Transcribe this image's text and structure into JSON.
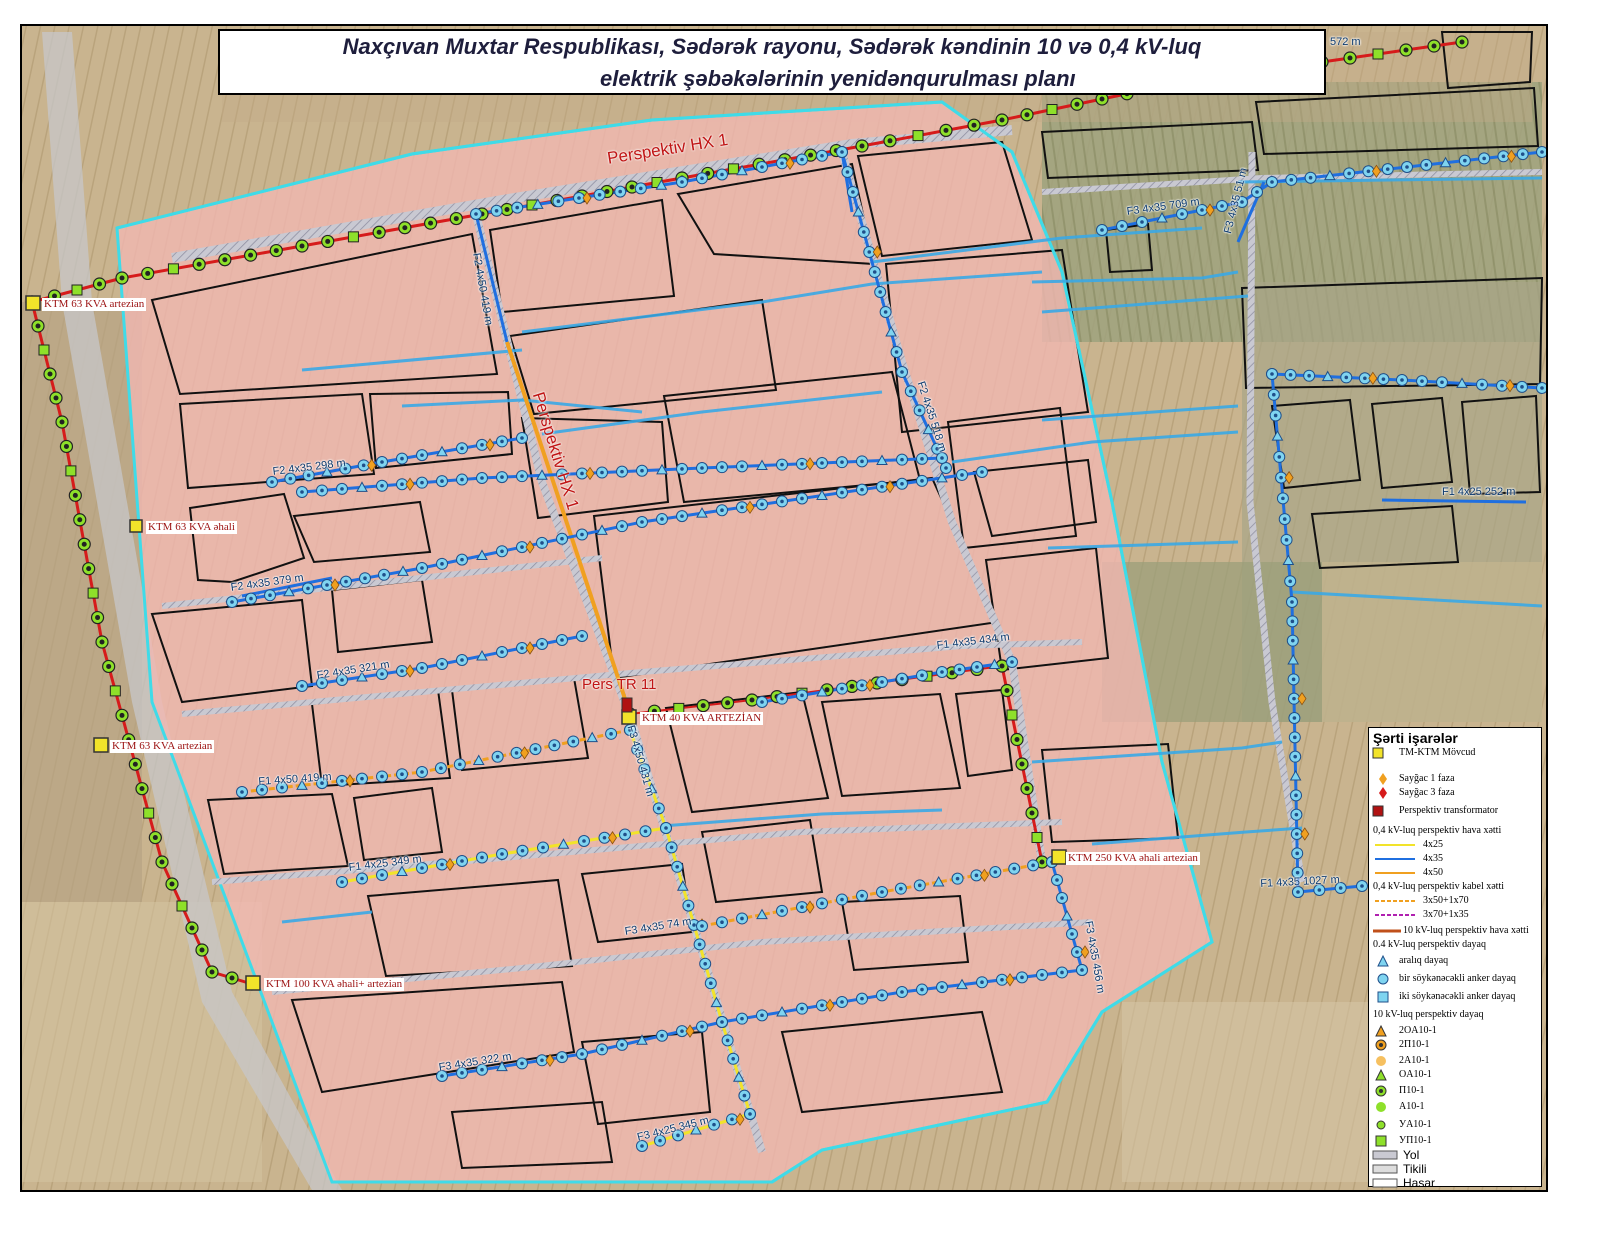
{
  "title": {
    "line1": "Naxçıvan Muxtar Respublikası,  Sədərək rayonu, Sədərək kəndinin 10 və 0,4 kV-luq",
    "line2": "elektrik şəbəkələrinin yenidənqurulması planı"
  },
  "hx_labels": {
    "top": "Perspektiv HX 1",
    "vertical": "Perspektiv HX 1"
  },
  "transformer_label": "Pers TR 11",
  "ktm_labels": {
    "ktm_63_artezian_top": "KTM 63 KVA artezian",
    "ktm_63_ahali": "KTM 63 KVA əhali",
    "ktm_63_artezian_left": "KTM 63 KVA artezian",
    "ktm_40": "KTM 40 KVA ARTEZİAN",
    "ktm_250": "KTM 250 KVA əhali artezian",
    "ktm_100": "KTM 100 KVA əhali+ artezian"
  },
  "line_labels": {
    "f2_450_419": "F2 4x50 419 m",
    "f2_298": "F2 4x35 298 m",
    "f2_379": "F2 4x35 379 m",
    "f2_321": "F2 4x35 321 m",
    "f1_419": "F1 4x50 419 m",
    "f1_349": "F1 4x25 349 m",
    "f3_431": "F3 4x50 431 m",
    "f3_574": "F3 4x35 74 m",
    "f3_322": "F3 4x35 322 m",
    "f3_345": "F3 4x25 345 m",
    "f2_518": "F2 4x35 518 m",
    "f1_434": "F1 4x35 434 m",
    "f3_456": "F3 4x35 456 m",
    "f3_709": "F3 4x35 709 m",
    "f3_51": "F3 4x35 51 m",
    "f1_252": "F1 4x25 252 m",
    "f1_1027": "F1 4x35 1027 m",
    "top_572": "572 m"
  },
  "legend": {
    "title": "Şərti işarələr",
    "items": [
      "TM-KTM Mövcud",
      "Sayğac 1 faza",
      "Sayğac 3 faza",
      "Perspektiv transformator",
      "0,4 kV-luq perspektiv hava xətti",
      "4x25",
      "4x35",
      "4x50",
      "0,4 kV-luq perspektiv kabel xətti",
      "3x50+1x70",
      "3x70+1x35",
      "10 kV-luq perspektiv hava xətti",
      "0.4 kV-luq perspektiv  dayaq",
      "aralıq dayaq",
      "bir söykənəcəkli anker dayaq",
      "iki söykənəcəkli anker dayaq",
      "10 kV-luq perspektiv dayaq",
      "2OA10-1",
      "2П10-1",
      "2A10-1",
      "OA10-1",
      "П10-1",
      "A10-1",
      "УA10-1",
      "УП10-1",
      "Yol",
      "Tikili",
      "Hasar"
    ]
  },
  "colors": {
    "hv_line": "#d61b1b",
    "lv_4x25": "#f2e32a",
    "lv_4x35": "#1f6fe0",
    "lv_4x50": "#f0a020",
    "cable": "#f0a020",
    "boundary": "#3fdbe8",
    "zone_fill": "#f2b7b2",
    "pole": "#7fd4f0",
    "meter": "#f0a020"
  }
}
